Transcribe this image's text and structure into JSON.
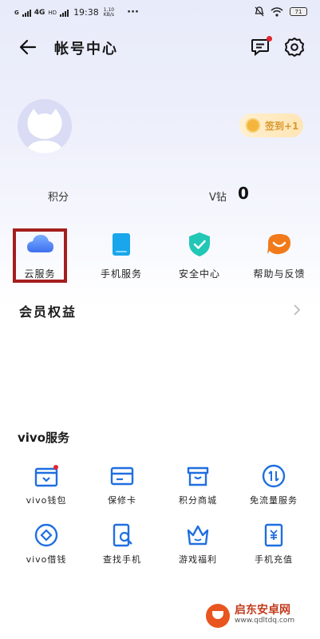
{
  "status_bar": {
    "carrier": "G",
    "network": "4G",
    "hd": "HD",
    "time": "19:38",
    "speed_value": "1.10",
    "speed_unit": "KB/s",
    "more": "···",
    "battery": "71"
  },
  "header": {
    "title": "帐号中心",
    "back_icon": "back-arrow-icon",
    "message_icon": "message-icon",
    "settings_icon": "gear-icon"
  },
  "profile": {
    "checkin_label": "签到+1",
    "points_label": "积分",
    "vdiamond_label": "V钻",
    "vdiamond_value": "0"
  },
  "services": [
    {
      "label": "云服务",
      "icon": "cloud-icon",
      "color": "#4a7ff0"
    },
    {
      "label": "手机服务",
      "icon": "phone-icon",
      "color": "#1aa3e8"
    },
    {
      "label": "安全中心",
      "icon": "shield-icon",
      "color": "#21c5b6"
    },
    {
      "label": "帮助与反馈",
      "icon": "smile-icon",
      "color": "#f07a1e"
    }
  ],
  "member": {
    "label": "会员权益"
  },
  "vivo_services": {
    "title": "vivo服务",
    "items": [
      {
        "label": "vivo钱包",
        "icon": "wallet-icon"
      },
      {
        "label": "保修卡",
        "icon": "card-icon"
      },
      {
        "label": "积分商城",
        "icon": "shop-icon"
      },
      {
        "label": "免流量服务",
        "icon": "data-free-icon"
      },
      {
        "label": "vivo借钱",
        "icon": "loan-icon"
      },
      {
        "label": "查找手机",
        "icon": "find-phone-icon"
      },
      {
        "label": "游戏福利",
        "icon": "crown-icon"
      },
      {
        "label": "手机充值",
        "icon": "recharge-icon"
      }
    ]
  },
  "watermark": {
    "name": "启东安卓网",
    "url": "www.qdltdq.com"
  },
  "colors": {
    "accent_blue": "#1f6fe0",
    "highlight_red": "#a51e1e",
    "badge_red": "#e2262f"
  }
}
